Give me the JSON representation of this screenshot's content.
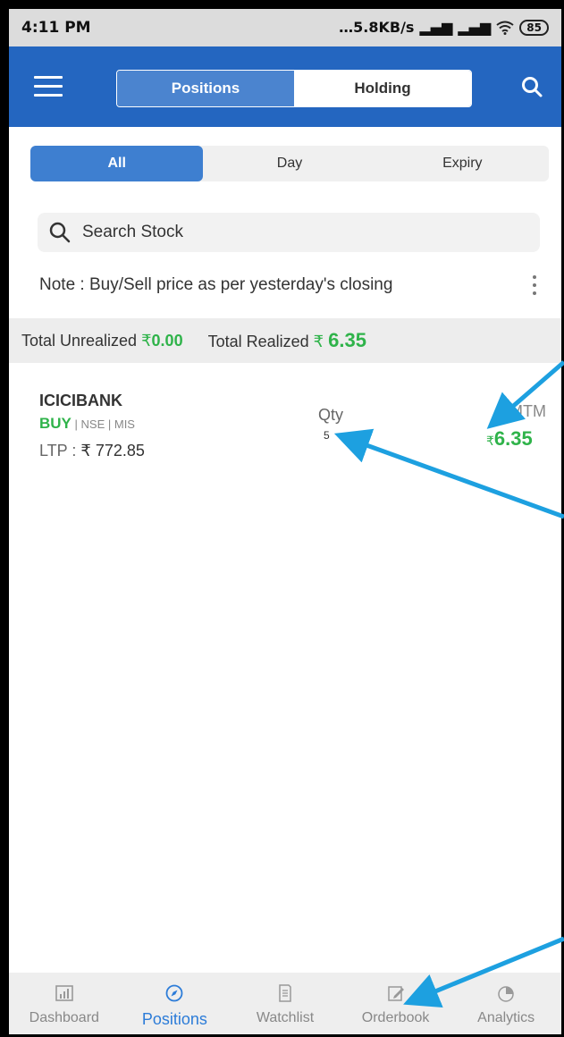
{
  "statusbar": {
    "time": "4:11 PM",
    "network": "5.8KB/s",
    "battery": "85"
  },
  "appbar": {
    "tab_positions": "Positions",
    "tab_holding": "Holding"
  },
  "filters": {
    "all": "All",
    "day": "Day",
    "expiry": "Expiry"
  },
  "search": {
    "placeholder": "Search Stock"
  },
  "note": "Note : Buy/Sell price as per yesterday's closing",
  "totals": {
    "unrealized_label": "Total Unrealized",
    "unrealized_value": "0.00",
    "realized_label": "Total Realized",
    "realized_value": "6.35",
    "currency": "₹"
  },
  "position": {
    "symbol": "ICICIBANK",
    "side": "BUY",
    "exchange": "NSE",
    "product": "MIS",
    "ltp_label": "LTP :",
    "ltp_value": "₹ 772.85",
    "qty_label": "Qty",
    "qty_value": "5",
    "mtm_label": "MTM",
    "mtm_currency": "₹",
    "mtm_value": "6.35"
  },
  "bottomnav": {
    "dashboard": "Dashboard",
    "positions": "Positions",
    "watchlist": "Watchlist",
    "orderbook": "Orderbook",
    "analytics": "Analytics"
  },
  "colors": {
    "appbar": "#2466c0",
    "accent": "#3e7fd0",
    "profit_green": "#2fb34a",
    "annotation_arrow": "#1da0e0"
  }
}
